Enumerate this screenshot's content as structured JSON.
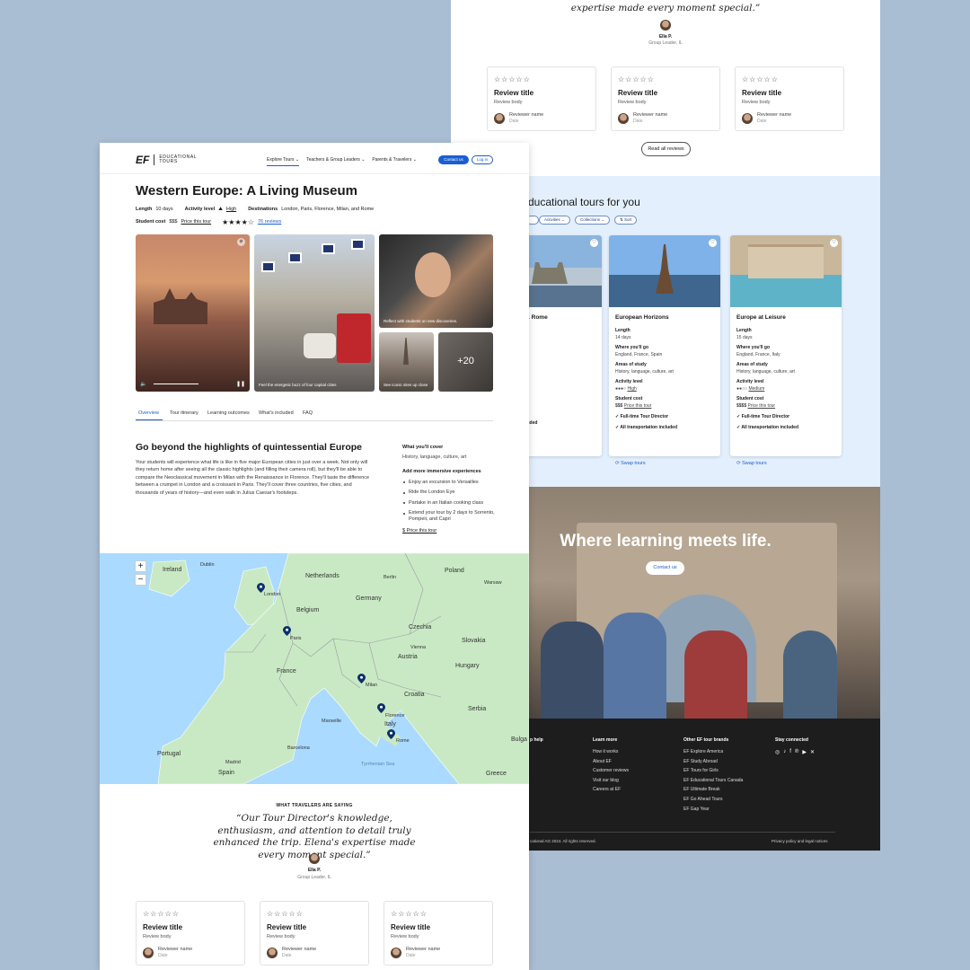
{
  "back_page": {
    "quote_tail": "expertise made every moment special.”",
    "reviewer": {
      "name": "Ella P.",
      "role": "Group Leader, IL"
    },
    "review_cards": [
      {
        "stars": "☆☆☆☆☆",
        "title": "Review title",
        "body": "Review body",
        "reviewer": "Reviewer name",
        "date": "Date"
      },
      {
        "stars": "☆☆☆☆☆",
        "title": "Review title",
        "body": "Review body",
        "reviewer": "Reviewer name",
        "date": "Date"
      },
      {
        "stars": "☆☆☆☆☆",
        "title": "Review title",
        "body": "Review body",
        "reviewer": "Reviewer name",
        "date": "Date"
      }
    ],
    "read_all_label": "Read all reviews",
    "tours_heading": "ducational tours for you",
    "filters": [
      "Activities",
      "Collections",
      "Sort"
    ],
    "tours": [
      {
        "name": "s, Florence & Rome",
        "length": "",
        "where": "",
        "areas": "taly",
        "areas2": "culture, art",
        "level": "",
        "cost": "",
        "director": "r Director",
        "transport": "nsportation included"
      },
      {
        "name": "European Horizons",
        "length_label": "Length",
        "length": "14 days",
        "where_label": "Where you'll go",
        "where": "England, France, Spain",
        "areas_label": "Areas of study",
        "areas": "History, language, culture, art",
        "level_label": "Activity level",
        "level_dots": "●●●○",
        "level": "High",
        "cost_label": "Student cost",
        "cost": "$$$",
        "price_link": "Price this tour",
        "director": "✓ Full-time Tour Director",
        "transport": "✓ All transportation included",
        "swap": "⟳ Swap tours"
      },
      {
        "name": "Europe at Leisure",
        "length_label": "Length",
        "length": "15 days",
        "where_label": "Where you'll go",
        "where": "England, France, Italy",
        "areas_label": "Areas of study",
        "areas": "History, language, culture, art",
        "level_label": "Activity level",
        "level_dots": "●●○○",
        "level": "Medium",
        "cost_label": "Student cost",
        "cost": "$$$$",
        "price_link": "Price this tour",
        "director": "✓ Full-time Tour Director",
        "transport": "✓ All transportation included",
        "swap": "⟳ Swap tours"
      }
    ],
    "hero_text": "Where learning meets life.",
    "contact_label": "Contact us",
    "footer": {
      "help_head": "p help",
      "learn_head": "Learn more",
      "learn": [
        "How it works",
        "About EF",
        "Customer reviews",
        "Visit our blog",
        "Careers at EF"
      ],
      "brands_head": "Other EF tour brands",
      "brands": [
        "EF Explore America",
        "EF Study Abroad",
        "EF Tours for Girls",
        "EF Educational Tours Canada",
        "EF Ultimate Break",
        "EF Go Ahead Tours",
        "EF Gap Year"
      ],
      "stay_head": "Stay connected",
      "copyright": "cational AG 2024. All rights reserved.",
      "privacy": "Privacy policy and legal notices"
    }
  },
  "front_page": {
    "logo": {
      "mark": "EF",
      "text1": "EDUCATIONAL",
      "text2": "TOURS"
    },
    "nav": [
      "Explore Tours ⌄",
      "Teachers & Group Leaders ⌄",
      "Parents & Travelers ⌄"
    ],
    "contact_button": "Contact us",
    "login_button": "Log in",
    "title": "Western Europe: A Living Museum",
    "length_label": "Length",
    "length": "10 days",
    "activity_label": "Activity level",
    "activity": "High",
    "destinations_label": "Destinations",
    "destinations": "London, Paris, Florence, Milan, and Rome",
    "cost_label": "Student cost",
    "cost": "$$$",
    "price_link": "Price this tour",
    "rating_stars": "★★★★☆",
    "reviews_link": "76 reviews",
    "captions": [
      "Feel the energetic buzz of four capital cities",
      "Reflect with students on new discoveries.",
      "See iconic sites up close",
      "+20"
    ],
    "tabs": [
      "Overview",
      "Tour itinerary",
      "Learning outcomes",
      "What's included",
      "FAQ"
    ],
    "overview_heading": "Go beyond the highlights of quintessential Europe",
    "overview_text": "Your students will experience what life is like in five major European cities in just over a week. Not only will they return home after seeing all the classic highlights (and filling their camera roll), but they'll be able to compare the Neoclassical movement in Milan with the Renaissance in Florence. They'll taste the difference between a crumpet in London and a croissant in Paris. They'll cover three countries, five cities, and thousands of years of history—and even walk in Julius Caesar's footsteps.",
    "cover_heading": "What you'll cover",
    "cover_text": "History, language, culture, art",
    "more_heading": "Add more immersive experiences",
    "more_items": [
      "Enjoy an excursion to Versailles",
      "Ride the London Eye",
      "Partake in an Italian cooking class",
      "Extend your tour by 2 days to Sorrento, Pompeii, and Capri"
    ],
    "price_link2": "$ Price this tour",
    "map": {
      "zoom_in": "+",
      "zoom_out": "−",
      "countries": [
        "Ireland",
        "Netherlands",
        "Poland",
        "Germany",
        "Belgium",
        "Czechia",
        "Slovakia",
        "France",
        "Austria",
        "Hungary",
        "Croatia",
        "Italy",
        "Serbia",
        "Portugal",
        "Spain",
        "Greece",
        "Bulga"
      ],
      "cities": [
        "Dublin",
        "Berlin",
        "Warsaw",
        "London",
        "Paris",
        "Vienna",
        "Milan",
        "Marseille",
        "Florence",
        "Rome",
        "Barcelona",
        "Madrid",
        "Tyrrhenian Sea"
      ]
    },
    "travelers_label": "WHAT TRAVELERS ARE SAYING",
    "quote": "“Our Tour Director's knowledge, enthusiasm, and attention to detail truly enhanced the trip. Elena's expertise made every moment special.”",
    "reviewer": {
      "name": "Ella P.",
      "role": "Group Leader, IL"
    },
    "review_cards": [
      {
        "stars": "☆☆☆☆☆",
        "title": "Review title",
        "body": "Review body",
        "reviewer": "Reviewer name",
        "date": "Date"
      },
      {
        "stars": "☆☆☆☆☆",
        "title": "Review title",
        "body": "Review body",
        "reviewer": "Reviewer name",
        "date": "Date"
      },
      {
        "stars": "☆☆☆☆☆",
        "title": "Review title",
        "body": "Review body",
        "reviewer": "Reviewer name",
        "date": "Date"
      }
    ]
  },
  "colors": {
    "background": "#a9bdd3",
    "accent": "#1a5ed1",
    "light_blue": "#e3effc",
    "footer": "#1d1d1d",
    "map_water": "#aadaff",
    "map_land": "#c9e9c4"
  }
}
